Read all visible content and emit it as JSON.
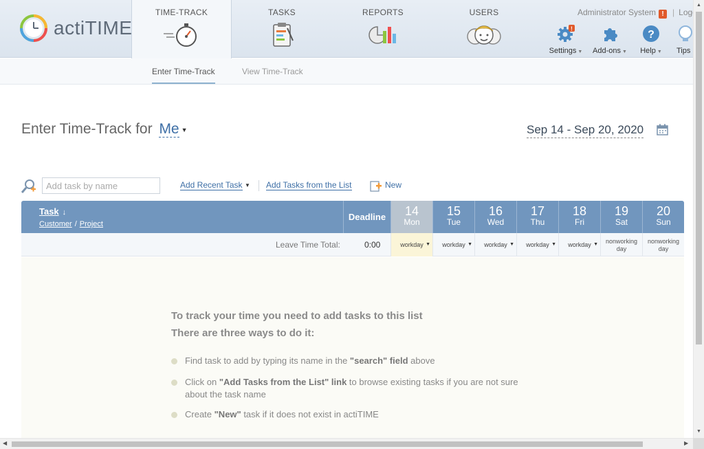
{
  "app": {
    "logo_text": "actiTIME",
    "colors": {
      "header_bg": "#dbe4ee",
      "grid_header": "#7196be",
      "link": "#3e6fa6",
      "today_col": "#b9c4cf",
      "today_cell": "#fbf5d8",
      "warning": "#e05a2b"
    }
  },
  "nav": {
    "tabs": [
      {
        "label": "TIME-TRACK",
        "icon": "stopwatch-icon",
        "active": true
      },
      {
        "label": "TASKS",
        "icon": "clipboard-icon",
        "active": false
      },
      {
        "label": "REPORTS",
        "icon": "report-chart-icon",
        "active": false
      },
      {
        "label": "USERS",
        "icon": "users-icon",
        "active": false
      }
    ],
    "user": {
      "name": "Administrator System",
      "warning": "!",
      "logout": "Logout"
    },
    "tools": [
      {
        "label": "Settings",
        "icon": "gear-icon",
        "badge": "!"
      },
      {
        "label": "Add-ons",
        "icon": "puzzle-icon"
      },
      {
        "label": "Help",
        "icon": "help-icon",
        "glyph": "?"
      },
      {
        "label": "Tips",
        "icon": "lightbulb-icon"
      }
    ]
  },
  "subnav": {
    "enter": "Enter Time-Track",
    "view": "View Time-Track"
  },
  "heading": {
    "prefix": "Enter Time-Track for",
    "user": "Me",
    "date_range": "Sep 14 - Sep 20, 2020"
  },
  "toolbar": {
    "search_placeholder": "Add task by name",
    "add_recent": "Add Recent Task",
    "add_from_list": "Add Tasks from the List",
    "new": "New"
  },
  "grid": {
    "task_header": "Task",
    "customer_header": "Customer",
    "separator": "/",
    "project_header": "Project",
    "deadline_header": "Deadline",
    "days": [
      {
        "num": "14",
        "name": "Mon",
        "status": "workday",
        "today": true
      },
      {
        "num": "15",
        "name": "Tue",
        "status": "workday"
      },
      {
        "num": "16",
        "name": "Wed",
        "status": "workday"
      },
      {
        "num": "17",
        "name": "Thu",
        "status": "workday"
      },
      {
        "num": "18",
        "name": "Fri",
        "status": "workday"
      },
      {
        "num": "19",
        "name": "Sat",
        "status_line1": "nonworking",
        "status_line2": "day"
      },
      {
        "num": "20",
        "name": "Sun",
        "status_line1": "nonworking",
        "status_line2": "day"
      }
    ],
    "leave_label": "Leave Time Total:",
    "leave_total": "0:00"
  },
  "empty": {
    "title_line1": "To track your time you need to add tasks to this list",
    "title_line2": "There are three ways to do it:",
    "tips": [
      {
        "pre": "Find task to add by typing its name in the ",
        "bold": "\"search\" field",
        "post": " above"
      },
      {
        "pre": "Click on ",
        "bold": "\"Add Tasks from the List\" link",
        "post": " to browse existing tasks if you are not sure about the task name"
      },
      {
        "pre": "Create ",
        "bold": "\"New\"",
        "post": " task if it does not exist in actiTIME"
      }
    ]
  }
}
